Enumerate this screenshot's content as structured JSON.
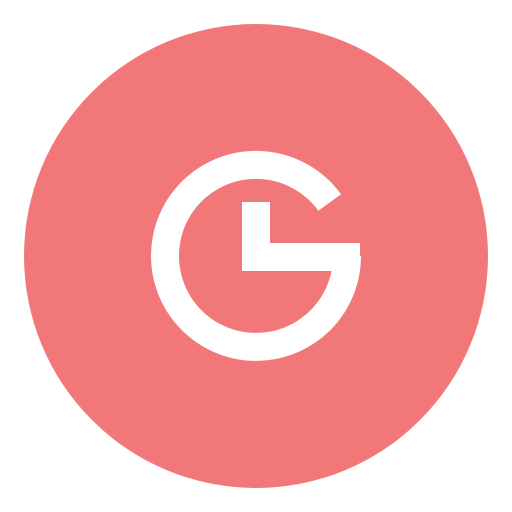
{
  "icon": {
    "name": "clock-g-logo-icon",
    "background_color": "#F27779",
    "glyph_color": "#FFFFFF"
  }
}
